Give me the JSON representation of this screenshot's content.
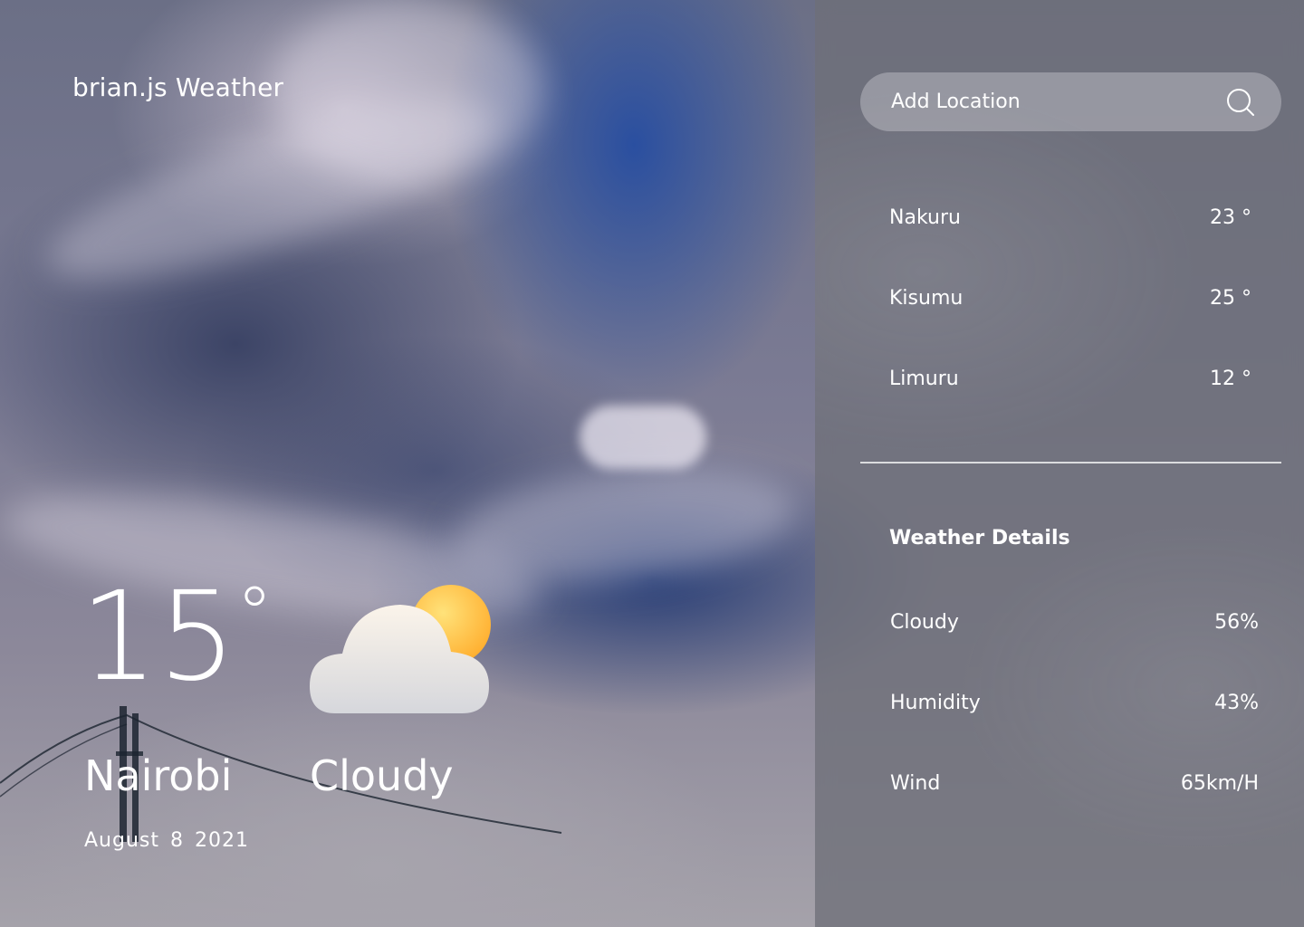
{
  "app": {
    "brand": "brian.js Weather"
  },
  "current": {
    "temperature": "15",
    "degree_symbol": "°",
    "city": "Nairobi",
    "date": "August 8 2021",
    "condition": "Cloudy",
    "icon": "cloud-sun-icon"
  },
  "search": {
    "placeholder": "Add Location",
    "value": "",
    "icon": "search-icon"
  },
  "locations": [
    {
      "name": "Nakuru",
      "temp": "23 °"
    },
    {
      "name": "Kisumu",
      "temp": "25 °"
    },
    {
      "name": "Limuru",
      "temp": "12 °"
    }
  ],
  "details": {
    "title": "Weather Details",
    "rows": [
      {
        "label": "Cloudy",
        "value": "56%"
      },
      {
        "label": "Humidity",
        "value": "43%"
      },
      {
        "label": "Wind",
        "value": "65km/H"
      }
    ]
  },
  "colors": {
    "panel": "#6e7078",
    "sun": "#ffb938",
    "text": "#ffffff"
  }
}
